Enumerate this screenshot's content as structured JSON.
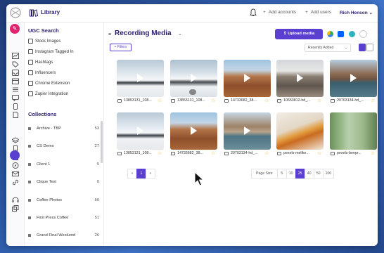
{
  "topbar": {
    "app_title": "Library",
    "add_accounts": "Add accounts",
    "add_users": "Add users",
    "user_name": "Rich Henson",
    "plus": "+",
    "chevron": "⌄"
  },
  "panel": {
    "ugc_title": "UGC Search",
    "search_items": [
      "Stock Images",
      "Instagram Tagged In",
      "Hashtags",
      "Influencers",
      "Chrome Extension",
      "Zapier Integration"
    ],
    "collections_title": "Collections",
    "collections": [
      {
        "name": "Archive - TBP",
        "count": "53"
      },
      {
        "name": "CS Demo",
        "count": "27"
      },
      {
        "name": "Client 1",
        "count": "5"
      },
      {
        "name": "Clique Test",
        "count": "0"
      },
      {
        "name": "Coffee Photos",
        "count": "50"
      },
      {
        "name": "First Press Coffee",
        "count": "51"
      },
      {
        "name": "Grand Final Weekend",
        "count": "26"
      }
    ]
  },
  "main": {
    "title": "Recording Media",
    "upload_label": "Upload media",
    "filters_label": "+ Filters",
    "sort_label": "Recently Added",
    "cards": [
      {
        "caption": "13853131_108...",
        "type": "video",
        "scene": "snow"
      },
      {
        "caption": "13853131_108...",
        "type": "video",
        "scene": "snow2"
      },
      {
        "caption": "14733682_38...",
        "type": "video",
        "scene": "desert"
      },
      {
        "caption": "10653812-hd_...",
        "type": "video",
        "scene": "rocks"
      },
      {
        "caption": "20703134-hd_...",
        "type": "video",
        "scene": "lake"
      },
      {
        "caption": "13853131_108...",
        "type": "video",
        "scene": "snow"
      },
      {
        "caption": "14733682_38...",
        "type": "video",
        "scene": "desert"
      },
      {
        "caption": "20703134-hd_...",
        "type": "video",
        "scene": "lake2"
      },
      {
        "caption": "pexels-melike...",
        "type": "image",
        "scene": "drinks"
      },
      {
        "caption": "pexels-benpr...",
        "type": "image",
        "scene": "door"
      }
    ]
  },
  "pagination": {
    "prev": "«",
    "current": "1",
    "next": "»",
    "page_size_label": "Page Size",
    "sizes": [
      "5",
      "10",
      "25",
      "40",
      "50",
      "100"
    ],
    "selected_size": "25"
  },
  "colors": {
    "accent": "#5b3fd0",
    "brand_pink": "#e0246f",
    "star": "#e7b11c",
    "title": "#2a1f6b"
  }
}
